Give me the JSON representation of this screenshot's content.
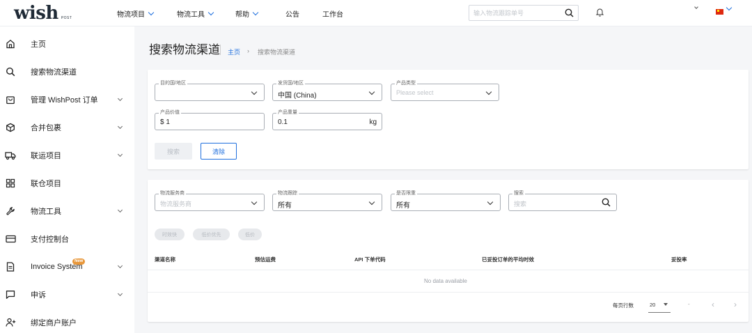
{
  "header": {
    "logo_main": "wish",
    "logo_sub": "POST",
    "nav": [
      {
        "label": "物流项目"
      },
      {
        "label": "物流工具"
      },
      {
        "label": "帮助"
      },
      {
        "label": "公告"
      },
      {
        "label": "工作台"
      }
    ],
    "search_placeholder": "输入物流跟踪单号",
    "icons": [
      "search-icon",
      "bell-icon",
      "chevron-down-icon",
      "china-flag-icon"
    ]
  },
  "sidebar": {
    "items": [
      {
        "label": "主页",
        "icon": "home-icon",
        "expandable": false
      },
      {
        "label": "搜索物流渠道",
        "icon": "search-icon",
        "expandable": false
      },
      {
        "label": "管理 WishPost 订单",
        "icon": "bag-icon",
        "expandable": true
      },
      {
        "label": "合并包裹",
        "icon": "package-icon",
        "expandable": true
      },
      {
        "label": "联运项目",
        "icon": "truck-icon",
        "expandable": true
      },
      {
        "label": "联仓项目",
        "icon": "grid-icon",
        "expandable": false
      },
      {
        "label": "物流工具",
        "icon": "wrench-icon",
        "expandable": true
      },
      {
        "label": "支付控制台",
        "icon": "credit-card-icon",
        "expandable": false
      },
      {
        "label": "Invoice System",
        "icon": "document-icon",
        "expandable": true,
        "badge": "New"
      },
      {
        "label": "申诉",
        "icon": "comment-icon",
        "expandable": true
      },
      {
        "label": "绑定商户账户",
        "icon": "add-user-icon",
        "expandable": false
      }
    ]
  },
  "page": {
    "title": "搜索物流渠道",
    "breadcrumb": [
      {
        "label": "主页"
      },
      {
        "label": "›"
      },
      {
        "label": "搜索物流渠道"
      }
    ]
  },
  "filters": {
    "destination": {
      "label": "目的国/地区",
      "value": ""
    },
    "origin": {
      "label": "发货国/地区",
      "value": "中国 (China)"
    },
    "product_type": {
      "label": "产品类型",
      "placeholder": "Please select"
    },
    "product_price": {
      "label": "产品价值",
      "value": "$ 1"
    },
    "product_weight": {
      "label": "产品重量",
      "value": "0.1",
      "unit": "kg"
    },
    "search_button": "搜索",
    "clear_button": "清除"
  },
  "results_filters": {
    "service_provider": {
      "label": "物流服务商",
      "placeholder": "物流服务商"
    },
    "tracking": {
      "label": "物流跟踪",
      "value": "所有"
    },
    "weight_limit": {
      "label": "是否限重",
      "value": "所有"
    },
    "search": {
      "label": "搜索",
      "placeholder": "搜索"
    }
  },
  "sort_chips": [
    "时效快",
    "低价优先",
    "低价"
  ],
  "table": {
    "columns": [
      "渠道名称",
      "预估运费",
      "API 下单代码",
      "已妥投订单的平均时效",
      "妥投率"
    ],
    "empty_text": "No data available"
  },
  "pagination": {
    "rows_per_page_label": "每页行数",
    "rows_per_page": "20",
    "range": "-",
    "prev": "‹",
    "next": "›"
  },
  "colors": {
    "accent": "#1f6fde",
    "badge": "#e8973a",
    "background": "#f5f6f8"
  }
}
